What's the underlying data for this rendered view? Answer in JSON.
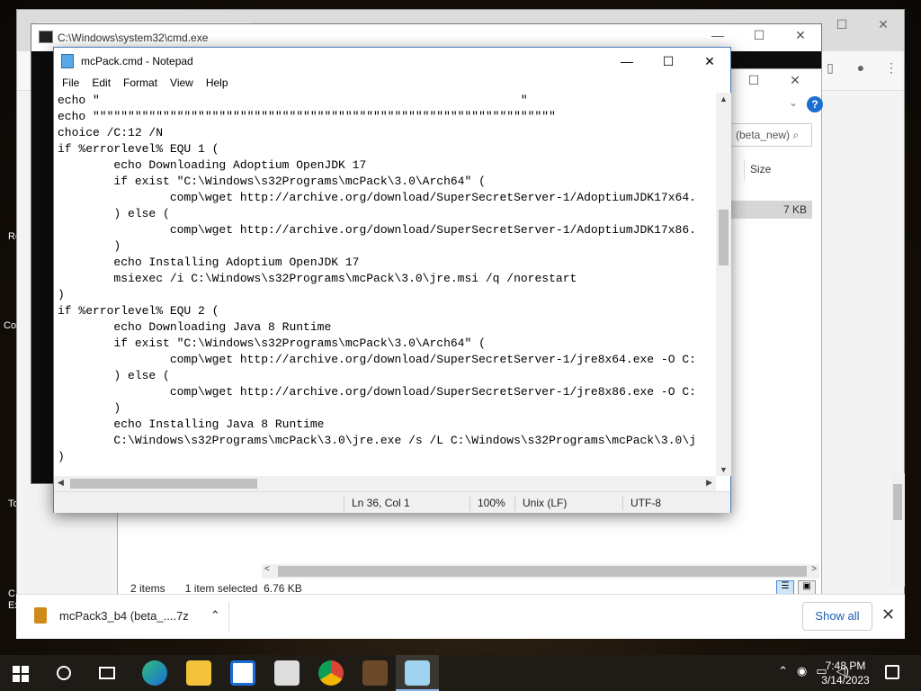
{
  "desktop": {
    "labels": [
      "Re",
      "Co",
      "To",
      "C\nEx"
    ]
  },
  "browser": {
    "tab_title": ""
  },
  "cmd": {
    "title": "C:\\Windows\\system32\\cmd.exe"
  },
  "explorer": {
    "search_placeholder": "(beta_new)",
    "size_header": "Size",
    "selected_row_size": "7 KB",
    "status_items": "2 items",
    "status_selected": "1 item selected",
    "status_size": "6.76 KB"
  },
  "downloads": {
    "file_name": "mcPack3_b4 (beta_....7z",
    "show_all": "Show all"
  },
  "notepad": {
    "title": "mcPack.cmd - Notepad",
    "menu": [
      "File",
      "Edit",
      "Format",
      "View",
      "Help"
    ],
    "lines": [
      "echo \"                                                            \"",
      "echo \"\"\"\"\"\"\"\"\"\"\"\"\"\"\"\"\"\"\"\"\"\"\"\"\"\"\"\"\"\"\"\"\"\"\"\"\"\"\"\"\"\"\"\"\"\"\"\"\"\"\"\"\"\"\"\"\"\"\"\"\"\"\"\"\"\"",
      "choice /C:12 /N",
      "if %errorlevel% EQU 1 (",
      "        echo Downloading Adoptium OpenJDK 17",
      "        if exist \"C:\\Windows\\s32Programs\\mcPack\\3.0\\Arch64\" (",
      "                comp\\wget http://archive.org/download/SuperSecretServer-1/AdoptiumJDK17x64.",
      "        ) else (",
      "                comp\\wget http://archive.org/download/SuperSecretServer-1/AdoptiumJDK17x86.",
      "        )",
      "        echo Installing Adoptium OpenJDK 17",
      "        msiexec /i C:\\Windows\\s32Programs\\mcPack\\3.0\\jre.msi /q /norestart",
      ")",
      "if %errorlevel% EQU 2 (",
      "        echo Downloading Java 8 Runtime",
      "        if exist \"C:\\Windows\\s32Programs\\mcPack\\3.0\\Arch64\" (",
      "                comp\\wget http://archive.org/download/SuperSecretServer-1/jre8x64.exe -O C:",
      "        ) else (",
      "                comp\\wget http://archive.org/download/SuperSecretServer-1/jre8x86.exe -O C:",
      "        )",
      "        echo Installing Java 8 Runtime",
      "        C:\\Windows\\s32Programs\\mcPack\\3.0\\jre.exe /s /L C:\\Windows\\s32Programs\\mcPack\\3.0\\j",
      ")"
    ],
    "status": {
      "position": "Ln 36, Col 1",
      "zoom": "100%",
      "line_ending": "Unix (LF)",
      "encoding": "UTF-8"
    }
  },
  "taskbar": {
    "time": "7:48 PM",
    "date": "3/14/2023",
    "apps": [
      "edge-icon",
      "file-explorer-icon",
      "store-icon",
      "mail-icon",
      "chrome-icon",
      "minecraft-icon",
      "notepad-icon"
    ]
  }
}
